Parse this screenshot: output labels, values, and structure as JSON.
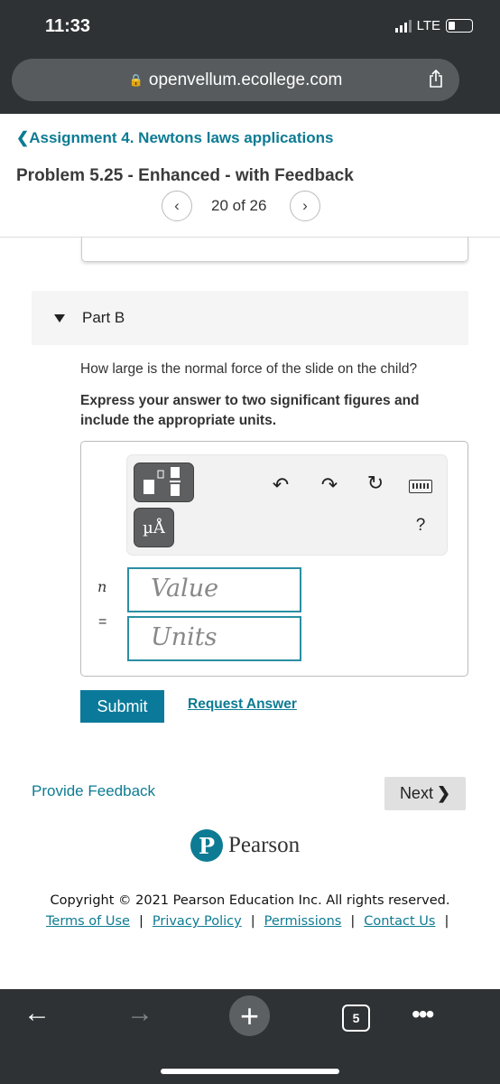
{
  "status_bar": {
    "time": "11:33",
    "network": "LTE"
  },
  "browser": {
    "url": "openvellum.ecollege.com",
    "tab_count": "5"
  },
  "header": {
    "breadcrumb": "Assignment 4. Newtons laws applications",
    "title": "Problem 5.25 - Enhanced - with Feedback",
    "pager": "20 of 26"
  },
  "part": {
    "label": "Part B",
    "question": "How large is the normal force of the slide on the child?",
    "instruction": "Express your answer to two significant figures and include the appropriate units."
  },
  "answer": {
    "variable": "n",
    "equals": "=",
    "value_placeholder": "Value",
    "units_placeholder": "Units",
    "units_button": "µÅ",
    "help": "?"
  },
  "actions": {
    "submit": "Submit",
    "request_answer": "Request Answer",
    "provide_feedback": "Provide Feedback",
    "next": "Next"
  },
  "footer": {
    "brand": "Pearson",
    "copyright": "Copyright © 2021 Pearson Education Inc. All rights reserved.",
    "links": [
      "Terms of Use",
      "Privacy Policy",
      "Permissions",
      "Contact Us"
    ]
  },
  "colors": {
    "accent": "#0d7b93",
    "submit": "#0b7a9a",
    "chrome": "#2f3234"
  }
}
